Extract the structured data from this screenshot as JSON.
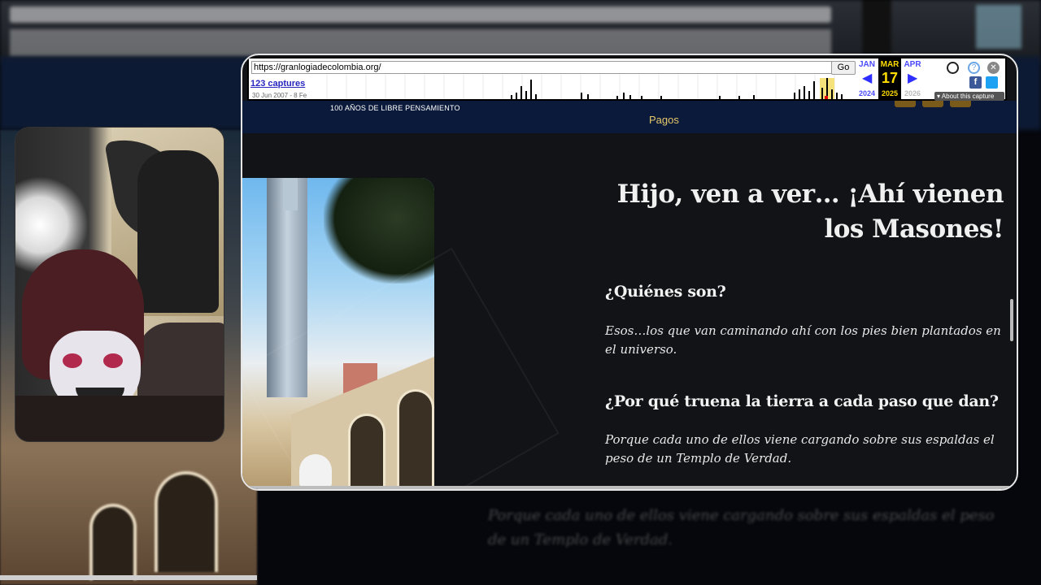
{
  "wayback": {
    "url": "https://granlogiadecolombia.org/",
    "go_label": "Go",
    "captures": "123 captures",
    "range": "30 Jun 2007 - 8 Fe",
    "prev_month": "JAN",
    "cur_month": "MAR",
    "next_month": "APR",
    "day": "17",
    "prev_year": "2024",
    "cur_year": "2025",
    "next_year": "2026",
    "about": "About this capture",
    "icons": [
      "user-icon",
      "help-icon",
      "close-icon",
      "facebook-icon",
      "twitter-icon"
    ],
    "colors": {
      "accent": "#4949ff",
      "highlight": "#ffdd00"
    }
  },
  "site": {
    "tagline": "100 AÑOS DE LIBRE PENSAMIENTO",
    "nav_pagos": "Pagos",
    "colors": {
      "header": "#0b1a3a",
      "gold": "#e5c86a",
      "body": "#111317"
    }
  },
  "article": {
    "title": "Hijo, ven a ver… ¡Ahí vienen los Masones!",
    "q1": "¿Quiénes son?",
    "a1": "Esos…los que van caminando ahí con los pies bien plantados en el universo.",
    "q2": "¿Por qué truena la tierra a cada paso que dan?",
    "a2": "Porque cada uno de ellos viene cargando sobre sus espaldas el peso de un Templo de Verdad."
  },
  "background": {
    "blurred_text": "Porque cada uno de ellos viene cargando sobre sus espaldas el peso de un Templo de Verdad."
  }
}
